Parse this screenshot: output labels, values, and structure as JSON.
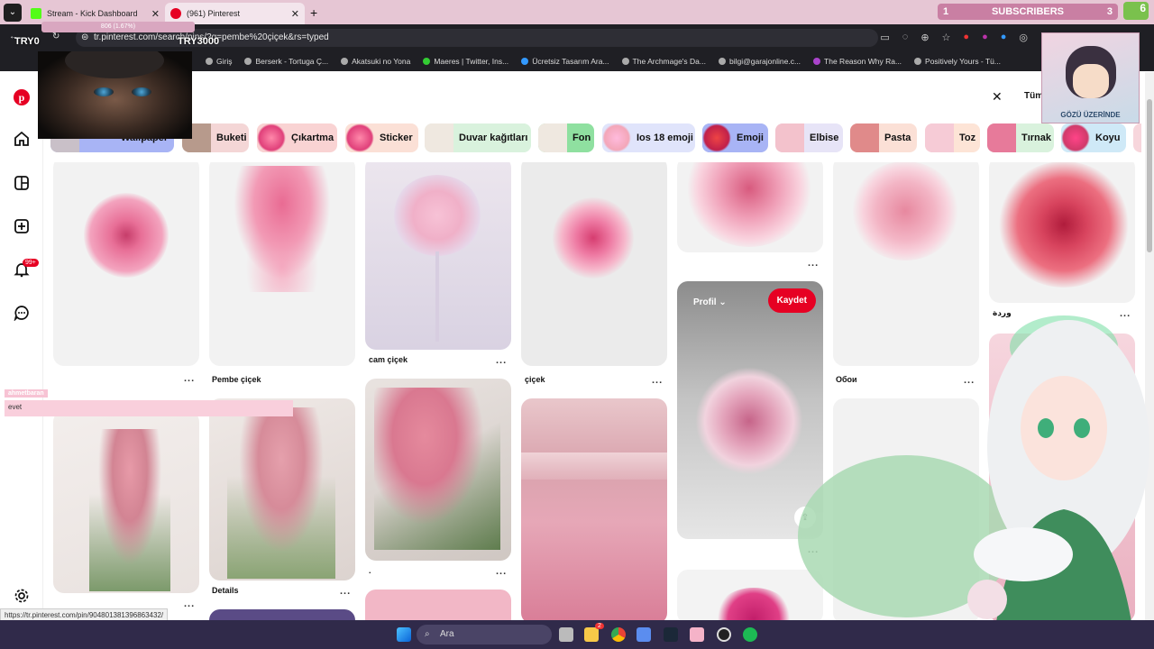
{
  "browser": {
    "tabs": [
      {
        "title": "Stream - Kick Dashboard",
        "active": false,
        "favicon_color": "#53fc18"
      },
      {
        "title": "(961) Pinterest",
        "active": true,
        "favicon_color": "#e60023"
      }
    ],
    "url": "tr.pinterest.com/search/pins/?q=pembe%20çiçek&rs=typed",
    "bookmarks": [
      "Giriş",
      "Berserk - Tortuga Ç...",
      "Akatsuki no Yona",
      "Maeres | Twitter, Ins...",
      "Ücretsiz Tasarım Ara...",
      "The Archmage's Da...",
      "bilgi@garajonline.c...",
      "The Reason Why Ra...",
      "Positively Yours - Tü..."
    ]
  },
  "stream_overlay": {
    "try_left": "TRY0",
    "try_right": "TRY3000",
    "goal_text": "806 (1.67%)",
    "subscribers_label": "SUBSCRIBERS",
    "subscribers_left": "1",
    "subscribers_right": "3",
    "chip_number": "6",
    "avatar_caption": "GÖZÜ ÜZERİNDE",
    "chat_name": "ahmetbaran",
    "chat_message": "evet"
  },
  "sidebar": {
    "notification_badge": "99+"
  },
  "search": {
    "close_symbol": "✕",
    "all_label": "Tüm"
  },
  "chips": [
    {
      "label": "Wallpaper",
      "bg": "#a8b4f5",
      "thumb": "#c9c0c8"
    },
    {
      "label": "Buketi",
      "bg": "#f4d6d6",
      "thumb": "#b79a8c"
    },
    {
      "label": "Çıkartma",
      "bg": "#f9d3d3",
      "thumb": "#e0407a"
    },
    {
      "label": "Sticker",
      "bg": "#fbe0d6",
      "thumb": "#e0407a"
    },
    {
      "label": "Duvar kağıtları",
      "bg": "#d9f2dd",
      "thumb": "#efe8e0"
    },
    {
      "label": "Fon",
      "bg": "#8fe0a0",
      "thumb": "#efe8e0"
    },
    {
      "label": "Ios 18 emoji",
      "bg": "#e0e4fb",
      "thumb": "#f3a6b8"
    },
    {
      "label": "Emoji",
      "bg": "#a8b4f5",
      "thumb": "#c0204a"
    },
    {
      "label": "Elbise",
      "bg": "#e7e4f7",
      "thumb": "#f3c2cc"
    },
    {
      "label": "Pasta",
      "bg": "#fbe0d6",
      "thumb": "#e08a8a"
    },
    {
      "label": "Toz",
      "bg": "#fde4d6",
      "thumb": "#f6cbd6"
    },
    {
      "label": "Tırnak",
      "bg": "#d9f2dd",
      "thumb": "#e77a9a"
    },
    {
      "label": "Koyu",
      "bg": "#cfe9f7",
      "thumb": "#d03a6a"
    }
  ],
  "pins": {
    "titles": {
      "pembe_cicek": "Pembe çiçek",
      "cam_cicek": "cam çiçek",
      "cicek": "çiçek",
      "oboi": "Обои",
      "warda": "وردة",
      "details": "Details",
      "dot": "."
    },
    "more": "...",
    "hover": {
      "profil_label": "Profil",
      "save_label": "Kaydet"
    }
  },
  "status_url": "https://tr.pinterest.com/pin/904801381396863432/",
  "taskbar": {
    "search_label": "Ara",
    "notif_count": "2"
  }
}
